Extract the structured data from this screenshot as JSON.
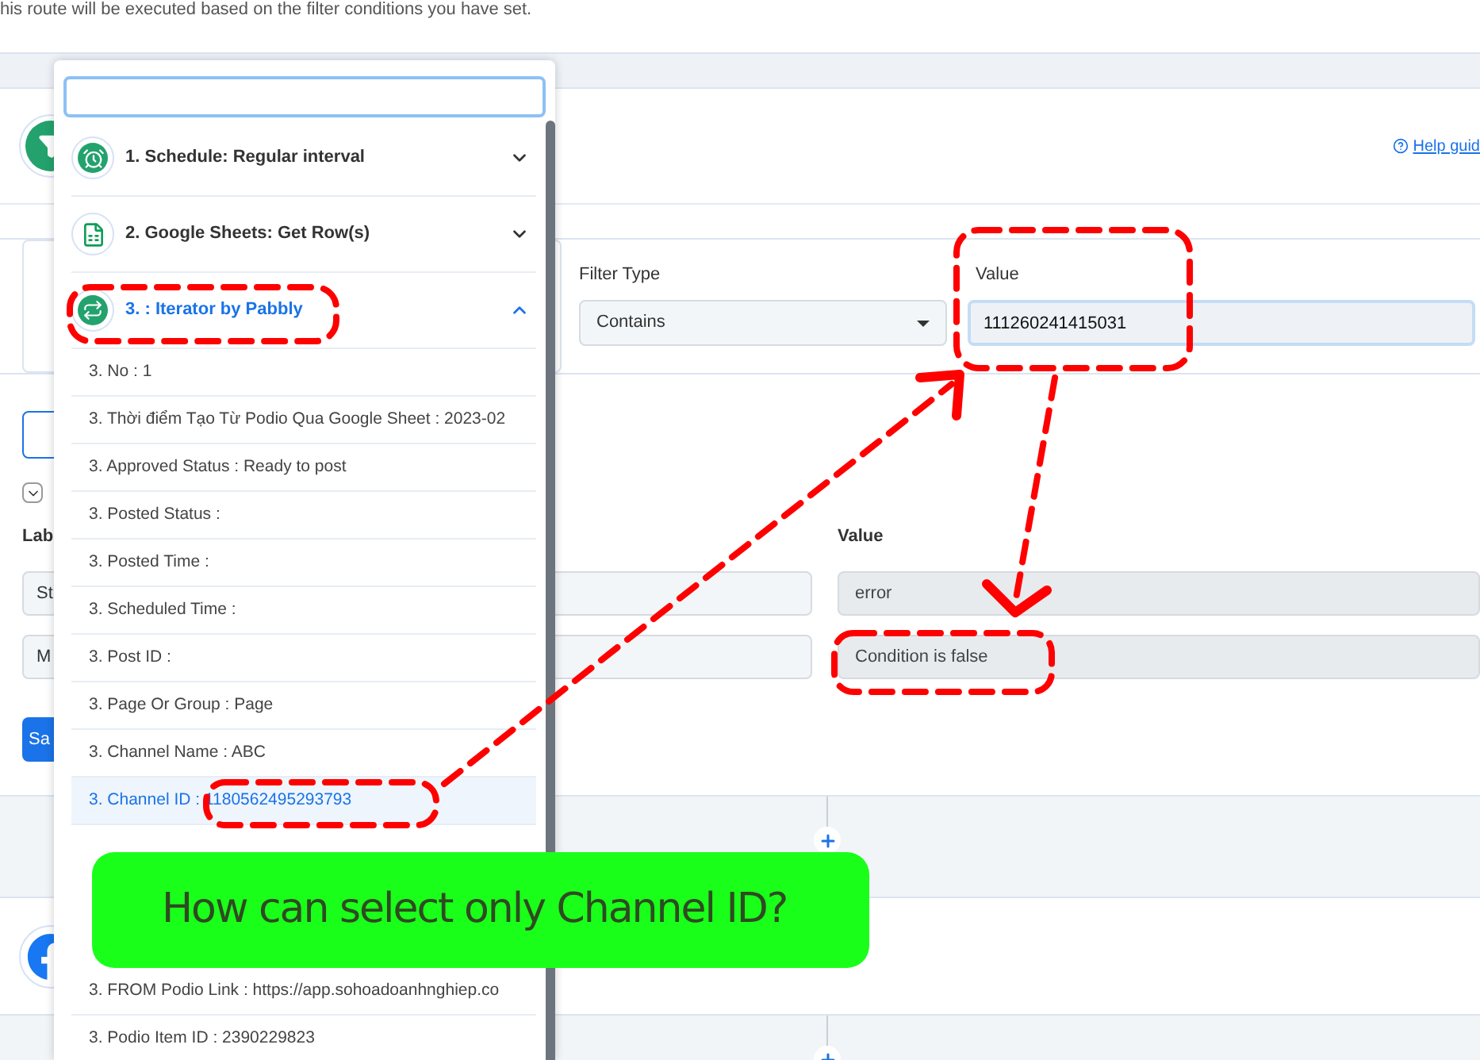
{
  "page_note": "his route will be executed based on the filter conditions you have set.",
  "help_link": "Help guid",
  "filter": {
    "filter_type_label": "Filter Type",
    "filter_type": "Contains",
    "value_label": "Value",
    "value": "111260241415031"
  },
  "mapping": {
    "label_column": "Lab",
    "value_column": "Value",
    "rows": [
      {
        "label": "St",
        "value": "error"
      },
      {
        "label": "M",
        "value": "Condition is false"
      }
    ]
  },
  "save_button": "Sa",
  "dropdown": {
    "apps": [
      {
        "title": "1. Schedule: Regular interval",
        "kind": "schedule",
        "expanded": false
      },
      {
        "title": "2. Google Sheets: Get Row(s)",
        "kind": "sheets",
        "expanded": false
      },
      {
        "title": "3. : Iterator by Pabbly",
        "kind": "iterator",
        "expanded": true
      }
    ],
    "fields": [
      {
        "label": "3. No : 1",
        "selected": false
      },
      {
        "label": "3. Thời điểm Tạo Từ Podio Qua Google Sheet : 2023-02",
        "selected": false
      },
      {
        "label": "3. Approved Status : Ready to post",
        "selected": false
      },
      {
        "label": "3. Posted Status :",
        "selected": false
      },
      {
        "label": "3. Posted Time :",
        "selected": false
      },
      {
        "label": "3. Scheduled Time :",
        "selected": false
      },
      {
        "label": "3. Post ID :",
        "selected": false
      },
      {
        "label": "3. Page Or Group : Page",
        "selected": false
      },
      {
        "label": "3. Channel Name : ABC",
        "selected": false
      },
      {
        "label": "3. Channel ID : 1180562495293793",
        "selected": true
      }
    ],
    "fields_below_callout": [
      {
        "label": "3. FROM Podio Link : https://app.sohoadoanhnghiep.co",
        "selected": false
      },
      {
        "label": "3. Podio Item ID : 2390229823",
        "selected": false
      }
    ]
  },
  "annotation": "How can  select only Channel ID?"
}
